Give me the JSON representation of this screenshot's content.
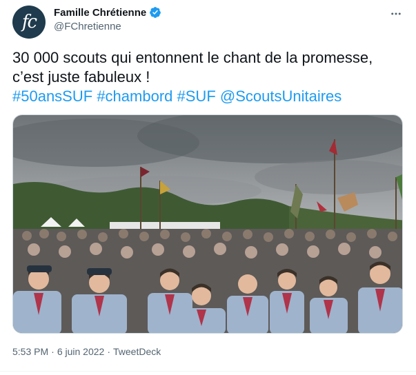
{
  "author": {
    "display_name": "Famille Chrétienne",
    "handle": "@FChretienne",
    "avatar_text": "fc"
  },
  "tweet": {
    "text_line1": "30 000 scouts qui entonnent le chant de la promesse,",
    "text_line2": "c’est juste fabuleux !",
    "hashtags": [
      "#50ansSUF",
      "#chambord",
      "#SUF",
      "@ScoutsUnitaires"
    ]
  },
  "meta": {
    "time": "5:53 PM",
    "separator1": "·",
    "date": "6 juin 2022",
    "separator2": "·",
    "source": "TweetDeck"
  },
  "colors": {
    "link": "#1d9bf0",
    "verified": "#1d9bf0",
    "secondary_text": "#536471"
  },
  "icons": {
    "verified": "verified-badge-icon",
    "more": "more-dots-icon"
  }
}
